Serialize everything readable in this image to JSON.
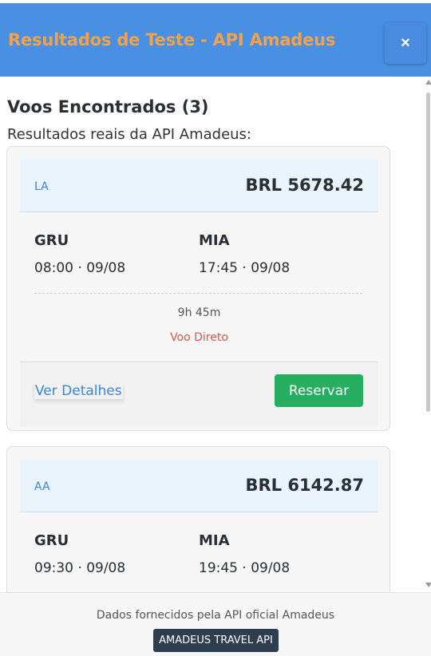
{
  "header": {
    "title": "Resultados de Teste - API Amadeus",
    "close_label": "×"
  },
  "results": {
    "title": "Voos Encontrados (3)",
    "subtitle": "Resultados reais da API Amadeus:"
  },
  "flights": [
    {
      "airline": "LA",
      "price": "BRL 5678.42",
      "origin": "GRU",
      "origin_time": "08:00 · 09/08",
      "destination": "MIA",
      "destination_time": "17:45 · 09/08",
      "duration": "9h 45m",
      "stops": "Voo Direto",
      "details_label": "Ver Detalhes",
      "reserve_label": "Reservar"
    },
    {
      "airline": "AA",
      "price": "BRL 6142.87",
      "origin": "GRU",
      "origin_time": "09:30 · 09/08",
      "destination": "MIA",
      "destination_time": "19:45 · 09/08"
    }
  ],
  "footer": {
    "text": "Dados fornecidos pela API oficial Amadeus",
    "badge": "AMADEUS TRAVEL API"
  },
  "colors": {
    "header_bg": "#4a90e2",
    "header_title": "#f2a24a",
    "accent_link": "#3a86d6",
    "reserve_green": "#27ae60",
    "direct_red": "#e0524c",
    "badge_bg": "#2c3e50"
  }
}
